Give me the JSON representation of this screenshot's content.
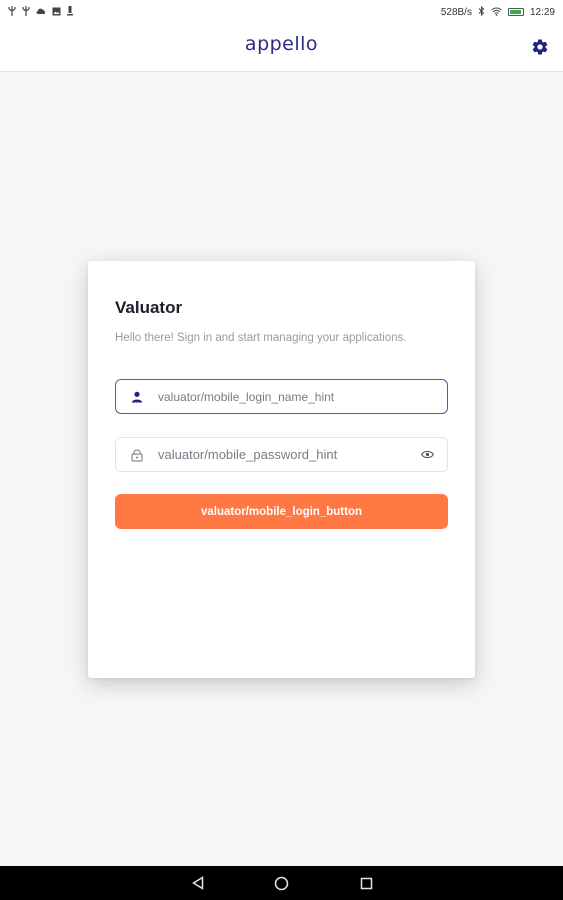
{
  "status_bar": {
    "left_icons": [
      "usb-icon",
      "usb-icon",
      "cloud-icon",
      "image-icon",
      "download-icon"
    ],
    "net_speed": "528B/s",
    "time": "12:29",
    "battery_level": 0.8
  },
  "app_bar": {
    "logo": "appello",
    "settings_icon": "gear-icon"
  },
  "login": {
    "title": "Valuator",
    "subtitle": "Hello there! Sign in and start managing your applications.",
    "username": {
      "placeholder": "valuator/mobile_login_name_hint",
      "value": ""
    },
    "password": {
      "placeholder": "valuator/mobile_password_hint",
      "value": ""
    },
    "button_label": "valuator/mobile_login_button"
  },
  "colors": {
    "accent": "#ff7844",
    "brand": "#2e2a86",
    "focus_border": "#5a5aa8"
  }
}
